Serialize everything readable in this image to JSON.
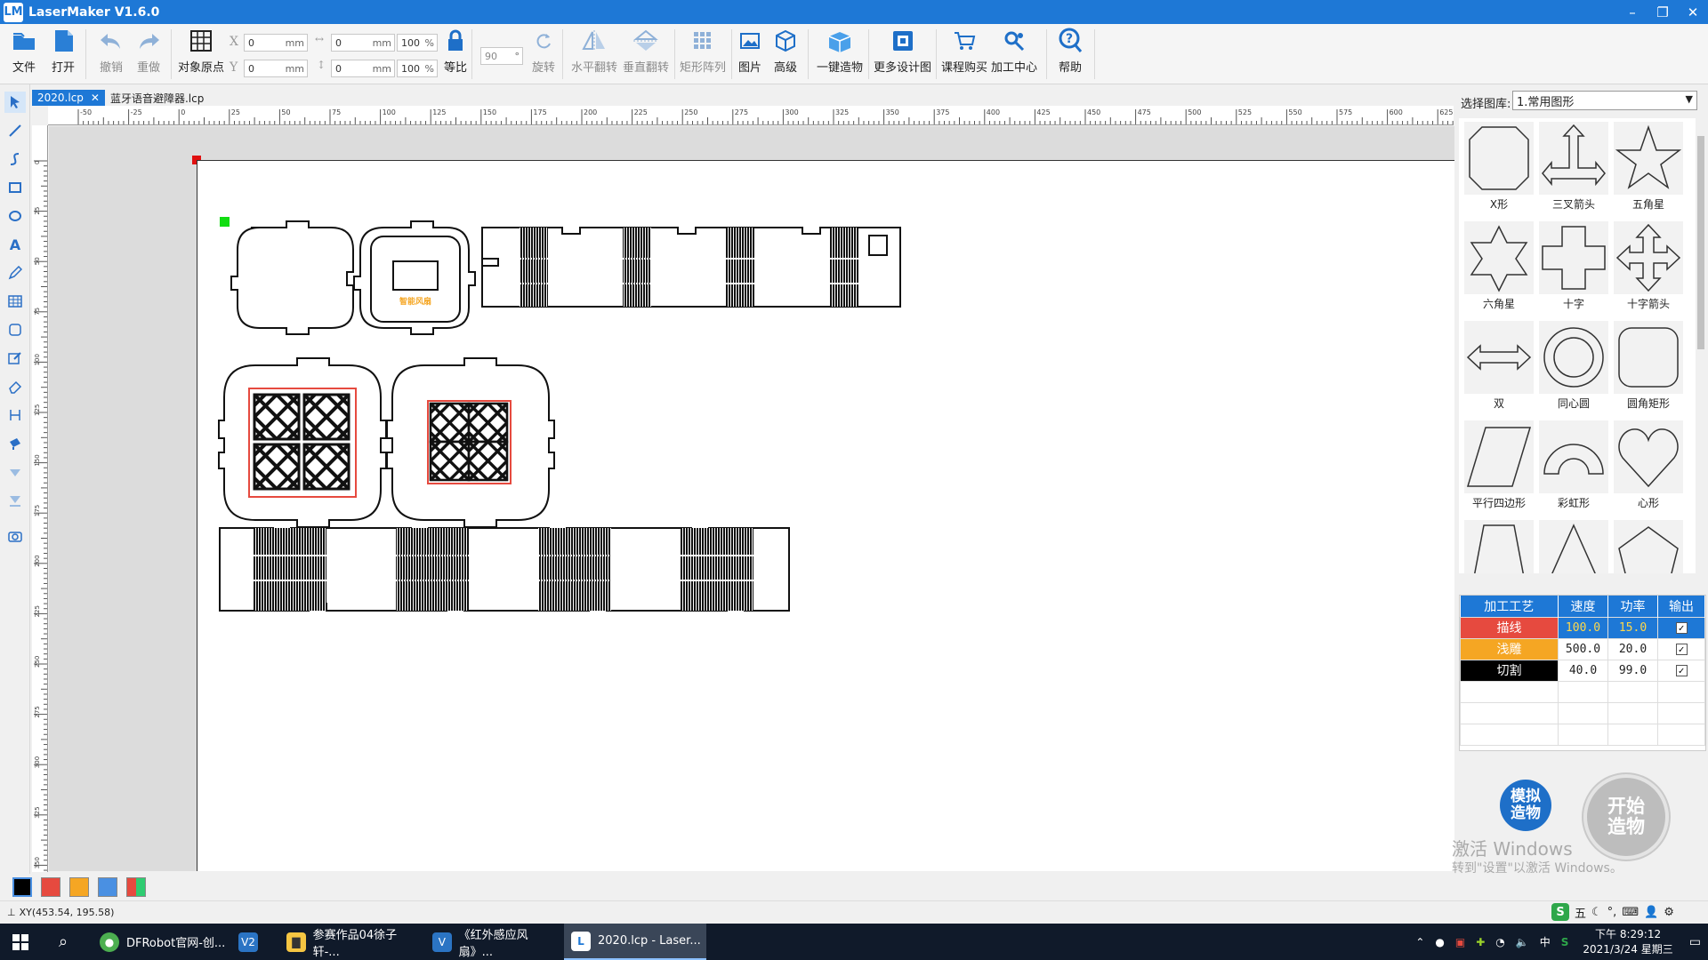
{
  "window": {
    "title": "LaserMaker V1.6.0",
    "app_icon": "LM",
    "minimize": "–",
    "restore": "❐",
    "close": "✕"
  },
  "toolbar": {
    "file": "文件",
    "open": "打开",
    "undo": "撤销",
    "redo": "重做",
    "origin": "对象原点",
    "x_label": "X",
    "y_label": "Y",
    "x_value": "0",
    "y_value": "0",
    "w_value": "0",
    "h_value": "0",
    "w_pct": "100",
    "h_pct": "100",
    "unit_mm": "mm",
    "unit_pct": "%",
    "lock": "等比",
    "angle_value": "90",
    "rotate": "旋转",
    "hflip": "水平翻转",
    "vflip": "垂直翻转",
    "array": "矩形阵列",
    "image": "图片",
    "advanced": "高级",
    "one_click": "一键造物",
    "more_designs": "更多设计图",
    "course": "课程购买",
    "processing_center": "加工中心",
    "help": "帮助"
  },
  "tabs": [
    {
      "label": "2020.lcp",
      "close": "✕"
    },
    {
      "label": "蓝牙语音避障器.lcp"
    }
  ],
  "ruler_top": [
    "-50",
    "-25",
    "0",
    "25",
    "50",
    "75",
    "100",
    "125",
    "150",
    "175",
    "200",
    "225",
    "250",
    "275",
    "300",
    "325",
    "350",
    "375",
    "400",
    "425",
    "450",
    "475",
    "500",
    "525",
    "550",
    "575",
    "600",
    "625"
  ],
  "ruler_left": [
    "0",
    "25",
    "50",
    "75",
    "100",
    "125",
    "150",
    "175",
    "200",
    "225",
    "250",
    "275",
    "300",
    "325",
    "350"
  ],
  "canvas": {
    "panel_label": "智能风扇"
  },
  "library": {
    "label": "选择图库:",
    "selected": "1.常用图形",
    "shapes": [
      "X形",
      "三叉箭头",
      "五角星",
      "六角星",
      "十字",
      "十字箭头",
      "双",
      "同心圆",
      "圆角矩形",
      "平行四边形",
      "彩虹形",
      "心形",
      "",
      "",
      ""
    ]
  },
  "layers": {
    "headers": [
      "加工工艺",
      "速度",
      "功率",
      "输出"
    ],
    "rows": [
      {
        "name": "描线",
        "speed": "100.0",
        "power": "15.0",
        "color": "#e64a3f",
        "checked": "✓"
      },
      {
        "name": "浅雕",
        "speed": "500.0",
        "power": "20.0",
        "color": "#f5a623",
        "checked": "✓"
      },
      {
        "name": "切割",
        "speed": "40.0",
        "power": "99.0",
        "color": "#000000",
        "checked": "✓"
      }
    ]
  },
  "buttons": {
    "simulate": "模拟造物",
    "start": "开始造物"
  },
  "watermark": {
    "line1": "激活 Windows",
    "line2": "转到\"设置\"以激活 Windows。"
  },
  "palette": [
    "#000000",
    "#e64a3f",
    "#f5a623",
    "#4a90e2",
    "multi"
  ],
  "status": {
    "coords": "XY(453.54, 195.58)"
  },
  "ime": {
    "mode": "五"
  },
  "taskbar": {
    "items": [
      {
        "label": "DFRobot官网-创...",
        "icon": "chrome-icon"
      },
      {
        "label": "",
        "icon": "vs-icon"
      },
      {
        "label": "参赛作品04徐子轩-...",
        "icon": "folder-icon"
      },
      {
        "label": "《红外感应风扇》...",
        "icon": "vs-icon"
      },
      {
        "label": "2020.lcp - Laser...",
        "icon": "lasermaker-icon"
      }
    ],
    "input_lang": "中",
    "time": "下午 8:29:12",
    "date": "2021/3/24 星期三"
  }
}
